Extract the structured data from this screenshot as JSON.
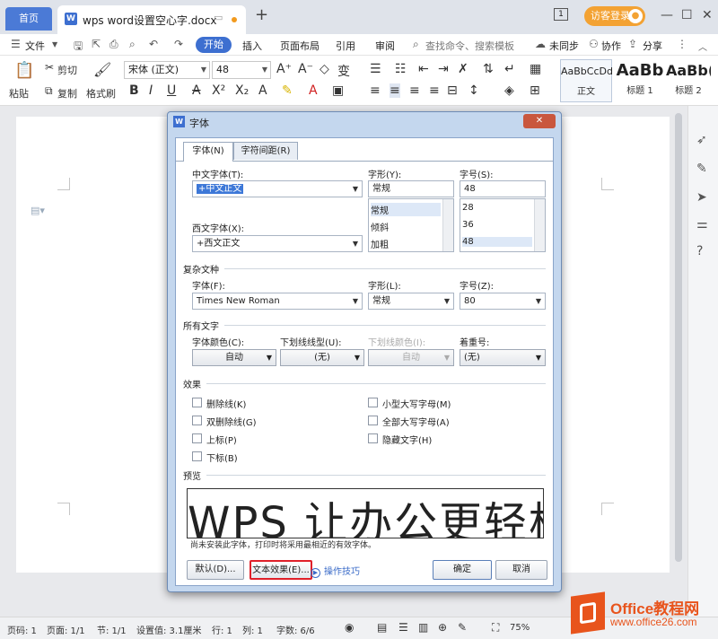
{
  "tabs": {
    "home": "首页",
    "doc_title": "wps word设置空心字.docx",
    "new_tab": "+",
    "badge": "1",
    "visitor": "访客登录"
  },
  "menu": {
    "file": "文件",
    "items": [
      "开始",
      "插入",
      "页面布局",
      "引用",
      "审阅"
    ],
    "search": "查找命令、搜索模板",
    "sync": "未同步",
    "collab": "协作",
    "share": "分享"
  },
  "ribbon": {
    "paste": "粘贴",
    "cut": "剪切",
    "copy": "复制",
    "format_painter": "格式刷",
    "font_name": "宋体 (正文)",
    "font_size": "48",
    "styles": [
      {
        "preview": "AaBbCcDd",
        "label": "正文"
      },
      {
        "preview": "AaBb",
        "label": "标题 1"
      },
      {
        "preview": "AaBb(",
        "label": "标题 2"
      }
    ]
  },
  "dialog": {
    "title": "字体",
    "close": "✕",
    "tab_font": "字体(N)",
    "tab_spacing": "字符间距(R)",
    "cn_font_label": "中文字体(T):",
    "cn_font_value": "+中文正文",
    "style_label": "字形(Y):",
    "style_value": "常规",
    "size_label": "字号(S):",
    "size_value": "48",
    "style_list": [
      "常规",
      "倾斜",
      "加粗"
    ],
    "size_list": [
      "28",
      "36",
      "48"
    ],
    "west_font_label": "西文字体(X):",
    "west_font_value": "+西文正文",
    "complex_section": "复杂文种",
    "complex_font_label": "字体(F):",
    "complex_font_value": "Times New Roman",
    "complex_style_label": "字形(L):",
    "complex_style_value": "常规",
    "complex_size_label": "字号(Z):",
    "complex_size_value": "80",
    "all_text_section": "所有文字",
    "color_label": "字体颜色(C):",
    "color_value": "自动",
    "underline_label": "下划线线型(U):",
    "underline_value": "(无)",
    "underline_color_label": "下划线颜色(I):",
    "underline_color_value": "自动",
    "emphasis_label": "着重号:",
    "emphasis_value": "(无)",
    "effects_section": "效果",
    "effects_left": [
      "删除线(K)",
      "双删除线(G)",
      "上标(P)",
      "下标(B)"
    ],
    "effects_right": [
      "小型大写字母(M)",
      "全部大写字母(A)",
      "隐藏文字(H)"
    ],
    "preview_section": "预览",
    "preview_text": "WPS 让办公更轻松",
    "preview_note": "尚未安装此字体，打印时将采用最相近的有效字体。",
    "btn_default": "默认(D)...",
    "btn_text_effect": "文本效果(E)...",
    "tips": "操作技巧",
    "btn_ok": "确定",
    "btn_cancel": "取消"
  },
  "status": {
    "page_no": "页码: 1",
    "pages": "页面: 1/1",
    "section": "节: 1/1",
    "setting": "设置值: 3.1厘米",
    "row": "行: 1",
    "col": "列: 1",
    "words": "字数: 6/6",
    "zoom": "75%"
  },
  "watermark": {
    "name": "Office教程网",
    "url": "www.office26.com"
  }
}
